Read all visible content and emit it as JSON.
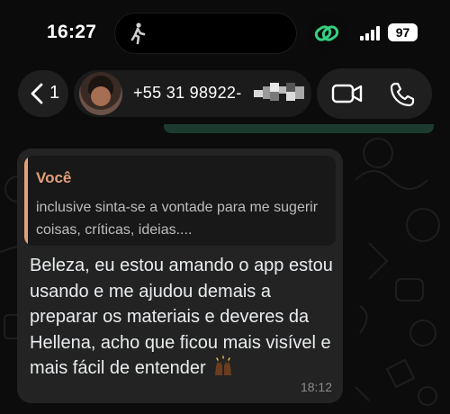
{
  "status_bar": {
    "time": "16:27",
    "battery": "97",
    "icons": [
      "walking-person-icon",
      "link-rings-icon",
      "signal-bars-icon",
      "battery-icon"
    ],
    "colors": {
      "link_icon": "#35d07f"
    }
  },
  "header": {
    "back_count": "1",
    "contact_number": "+55 31 98922-",
    "icons": [
      "chevron-left-icon",
      "video-camera-icon",
      "phone-icon"
    ]
  },
  "message": {
    "quote": {
      "author": "Você",
      "text": "inclusive sinta-se a vontade para me sugerir coisas, críticas, ideias...."
    },
    "text": "Beleza, eu estou amando o app estou usando e me ajudou demais a preparar os materiais e deveres da Hellena, acho que ficou mais visível e mais fácil de entender",
    "emoji": "raising-hands-icon",
    "time": "18:12"
  },
  "colors": {
    "bubble": "#232323",
    "quote_accent": "#e2a07b",
    "outgoing_bubble": "#1c3b2f"
  }
}
